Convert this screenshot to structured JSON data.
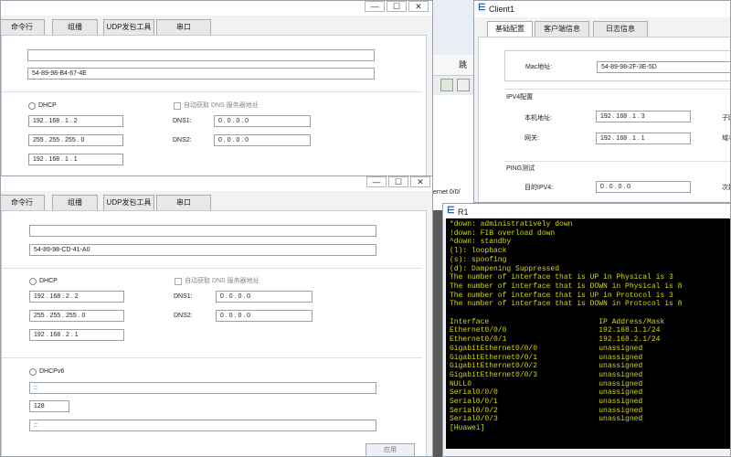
{
  "background_fragments": {
    "frag1": "跳",
    "frag2": "ernet 0/0/"
  },
  "window_a": {
    "tabs": [
      "命令行",
      "组播",
      "UDP发包工具",
      "串口"
    ],
    "mac": "54-89-98-B4-67-4E",
    "dhcp_label": "DHCP",
    "auto_dns_label": "自动获取 DNS 服务器地址",
    "ip": "192 . 168 . 1 . 2",
    "mask": "255 . 255 . 255 . 0",
    "gateway": "192 . 168 . 1 . 1",
    "dns1_label": "DNS1:",
    "dns2_label": "DNS2:",
    "dns1": "0 . 0 . 0 . 0",
    "dns2": "0 . 0 . 0 . 0"
  },
  "window_b": {
    "tabs": [
      "命令行",
      "组播",
      "UDP发包工具",
      "串口"
    ],
    "mac": "54-89-98-CD-41-A0",
    "dhcp_label": "DHCP",
    "auto_dns_label": "自动获取 DNS 服务器地址",
    "ip": "192 . 168 . 2 . 2",
    "mask": "255 . 255 . 255 . 0",
    "gateway": "192 . 168 . 2 . 1",
    "dns1_label": "DNS1:",
    "dns2_label": "DNS2:",
    "dns1": "0 . 0 . 0 . 0",
    "dns2": "0 . 0 . 0 . 0",
    "dhcpv6_label": "DHCPv6",
    "ipv6": "::",
    "prefix": "128",
    "ipv6_gw": "::",
    "apply_label": "应用"
  },
  "client1": {
    "title": "Client1",
    "tabs": [
      "基础配置",
      "客户端信息",
      "日志信息"
    ],
    "mac_label": "Mac地址:",
    "mac": "54-89-98-2F-3E-5D",
    "ipv4_section": "IPV4配置",
    "local_ip_label": "本机地址:",
    "local_ip": "192 . 168 . 1 . 3",
    "gateway_label": "网关:",
    "gateway": "192 . 168 . 1 . 1",
    "subnet_frag": "子网",
    "domain_frag": "域名",
    "ping_section": "PING测试",
    "dest_ipv4_label": "目的IPV4:",
    "dest_ipv4": "0 . 0 . 0 . 0",
    "count_frag": "次数"
  },
  "r1": {
    "title": "R1",
    "lines": [
      "*down: administratively down",
      "!down: FIB overload down",
      "^down: standby",
      "(l): loopback",
      "(s): spoofing",
      "(d): Dampening Suppressed",
      "The number of interface that is UP in Physical is 3",
      "The number of interface that is DOWN in Physical is 8",
      "The number of interface that is UP in Protocol is 3",
      "The number of interface that is DOWN in Protocol is 8",
      "",
      "Interface                         IP Address/Mask",
      "Ethernet0/0/0                     192.168.1.1/24",
      "Ethernet0/0/1                     192.168.2.1/24",
      "GigabitEthernet0/0/0              unassigned",
      "GigabitEthernet0/0/1              unassigned",
      "GigabitEthernet0/0/2              unassigned",
      "GigabitEthernet0/0/3              unassigned",
      "NULL0                             unassigned",
      "Serial0/0/0                       unassigned",
      "Serial0/0/1                       unassigned",
      "Serial0/0/2                       unassigned",
      "Serial0/0/3                       unassigned",
      "[Huawei]"
    ]
  }
}
